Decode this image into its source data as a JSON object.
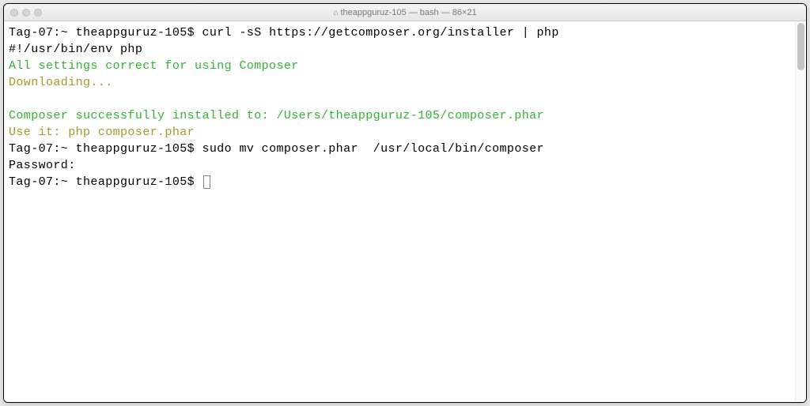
{
  "window": {
    "title": "theappguruz-105 — bash — 86×21",
    "home_icon": "⌂"
  },
  "terminal": {
    "lines": [
      {
        "prompt": "Tag-07:~ theappguruz-105$ ",
        "command": "curl -sS https://getcomposer.org/installer | php"
      },
      {
        "text": "#!/usr/bin/env php"
      },
      {
        "text": "All settings correct for using Composer",
        "class": "green"
      },
      {
        "text": "Downloading...",
        "class": "olive"
      },
      {
        "text": ""
      },
      {
        "text": "Composer successfully installed to: /Users/theappguruz-105/composer.phar",
        "class": "green"
      },
      {
        "text": "Use it: php composer.phar",
        "class": "olive"
      },
      {
        "prompt": "Tag-07:~ theappguruz-105$ ",
        "command": "sudo mv composer.phar  /usr/local/bin/composer"
      },
      {
        "text": "Password:"
      },
      {
        "prompt": "Tag-07:~ theappguruz-105$ ",
        "cursor": true
      }
    ]
  }
}
